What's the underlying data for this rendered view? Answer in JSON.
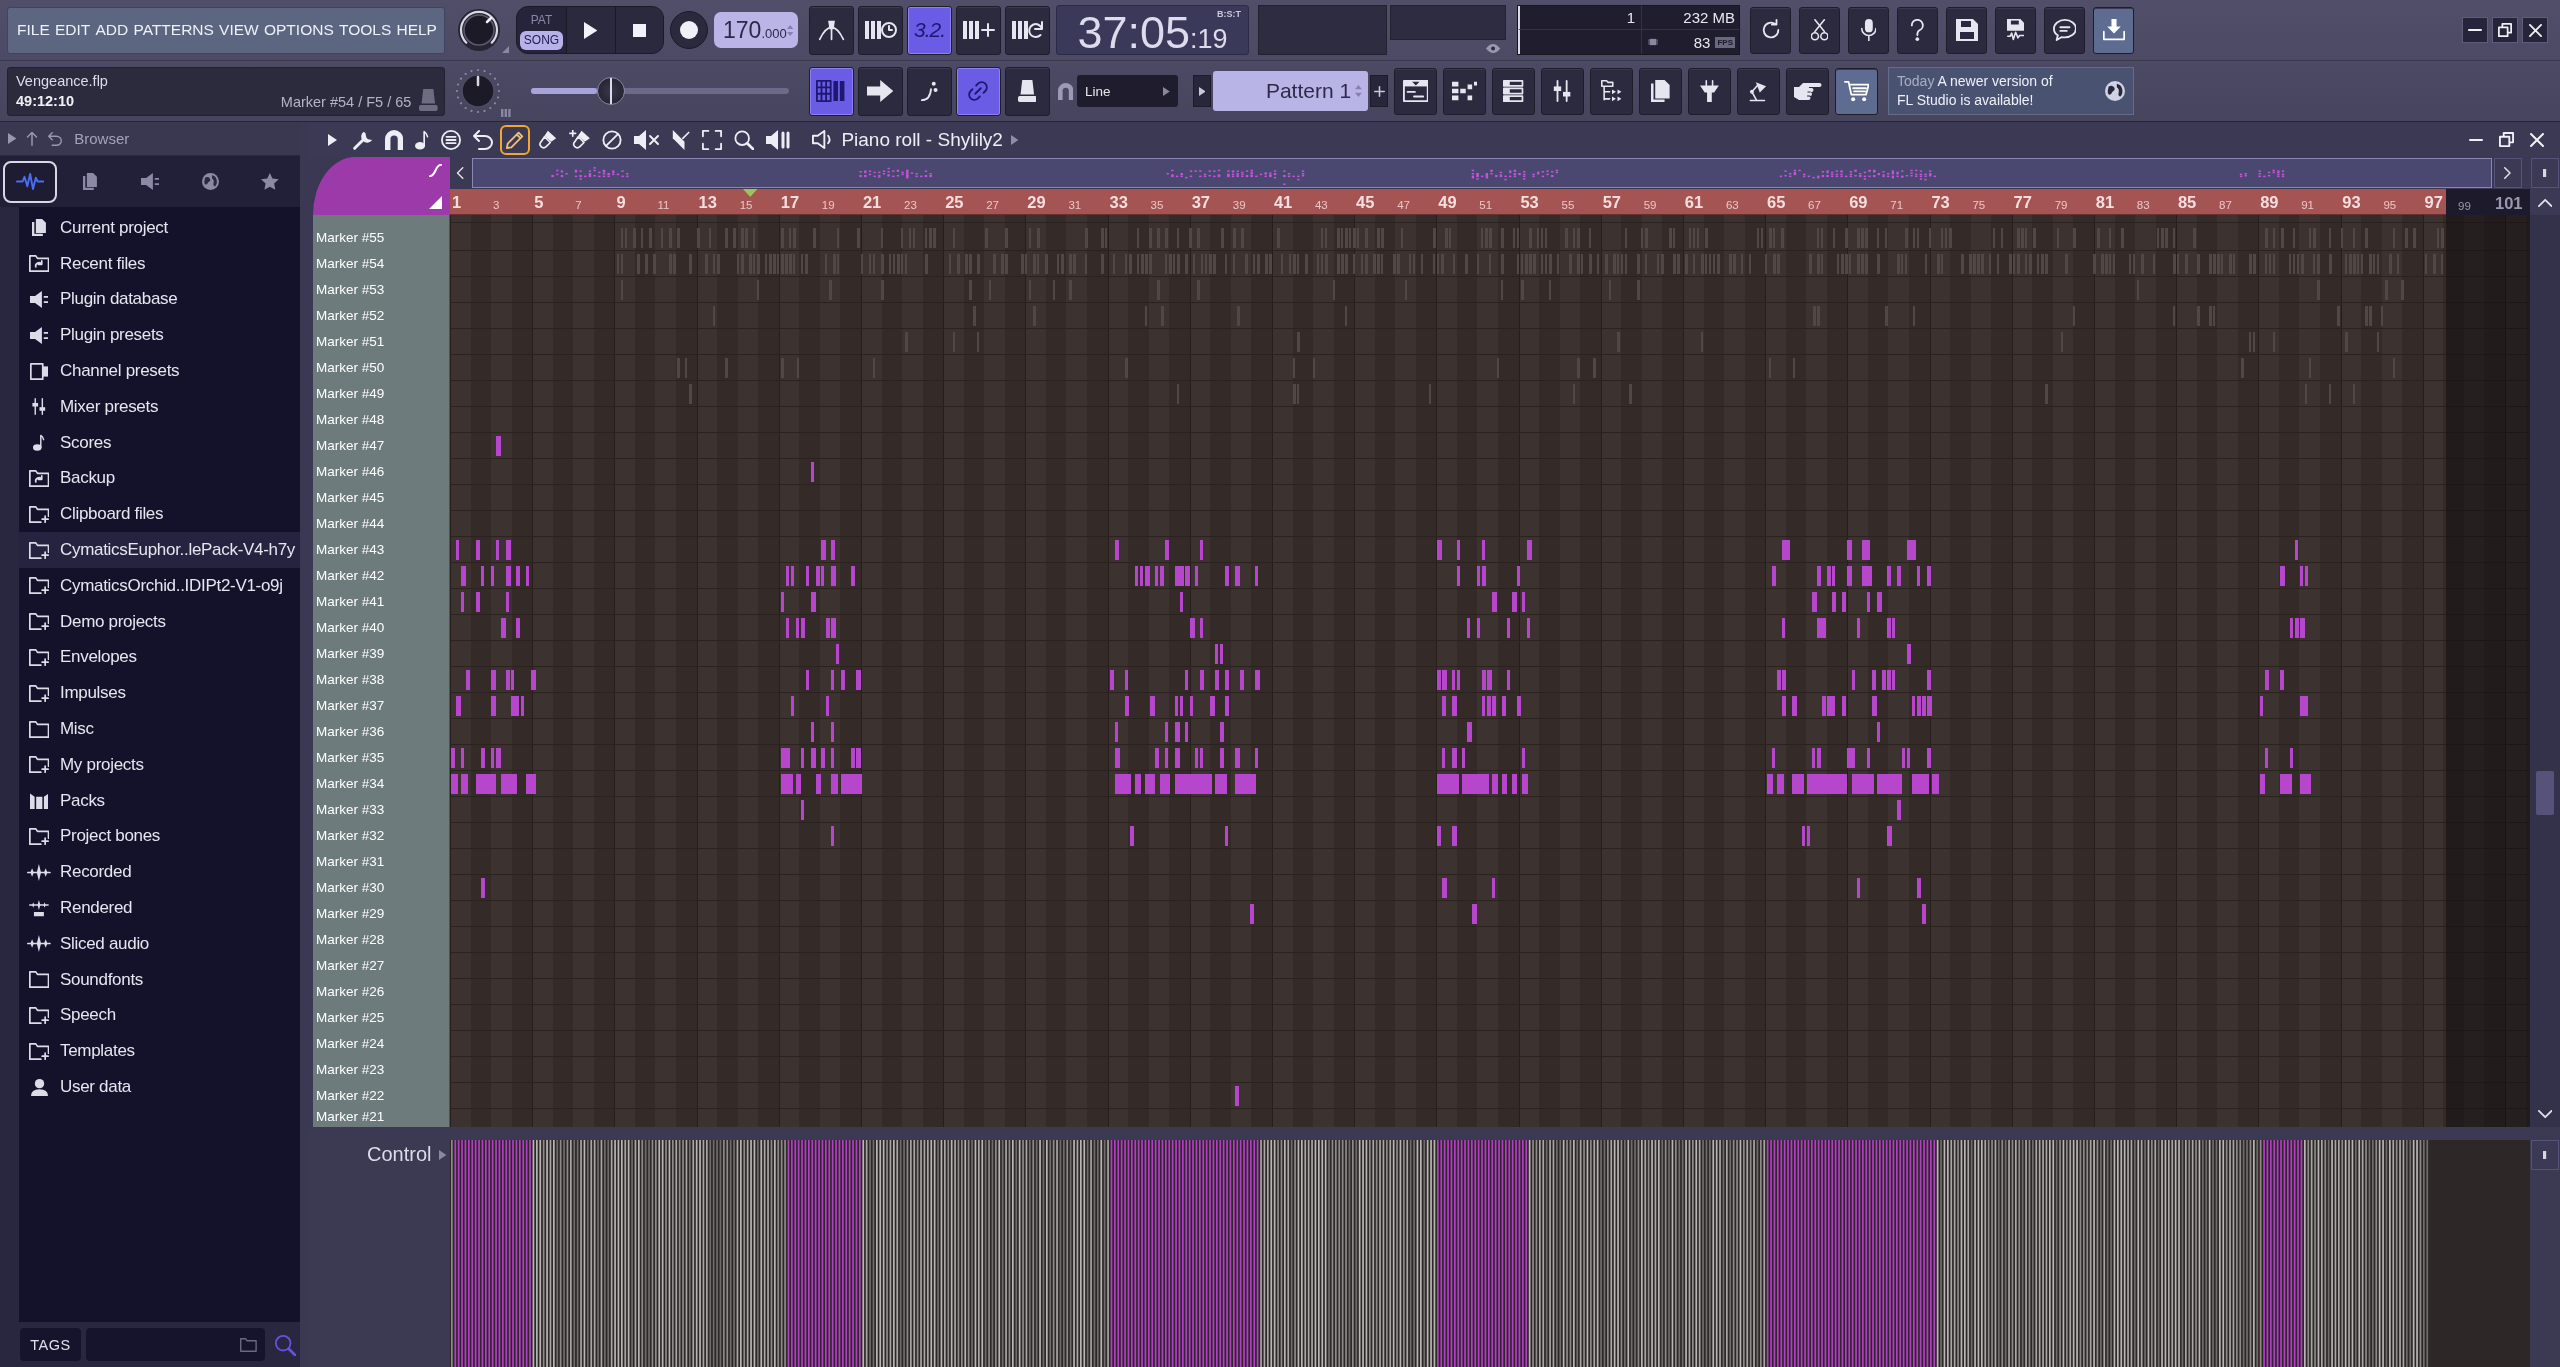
{
  "menu": [
    "FILE",
    "EDIT",
    "ADD",
    "PATTERNS",
    "VIEW",
    "OPTIONS",
    "TOOLS",
    "HELP"
  ],
  "hint_panel": {
    "project": "Vengeance.flp",
    "position": "49:12:10",
    "hint": "Marker #54 / F5 / 65"
  },
  "transport": {
    "modes": [
      {
        "label": "PAT",
        "selected": false
      },
      {
        "label": "SONG",
        "selected": true
      }
    ],
    "tempo_whole": "170",
    "tempo_fraction": ".000"
  },
  "pitch_slider": {
    "level": 0.31
  },
  "tool_buttons_top": [
    {
      "selected": false
    },
    {
      "selected": false
    },
    {
      "label": "3.2.",
      "selected": true
    },
    {
      "selected": false
    },
    {
      "selected": false
    }
  ],
  "tool_buttons_bottom": [
    {
      "selected": true
    },
    {
      "selected": false
    },
    {
      "selected": false
    },
    {
      "selected": true
    },
    {
      "selected": false
    }
  ],
  "time_display": {
    "value": "37:05",
    "fine": ":19",
    "format": "B:S:T"
  },
  "monitor": {
    "polyphony": "1",
    "memory": "232 MB",
    "cpu": "83",
    "fps_label": "FPS"
  },
  "shortcut_buttons": [
    {
      "highlighted": false
    },
    {
      "highlighted": false
    },
    {
      "highlighted": false
    },
    {
      "highlighted": false
    },
    {
      "highlighted": false
    },
    {
      "highlighted": false
    },
    {
      "highlighted": false
    },
    {
      "highlighted": true
    }
  ],
  "snap": {
    "value": "Line"
  },
  "pattern": {
    "name": "Pattern 1"
  },
  "window_buttons": [
    {
      "highlighted": false
    },
    {
      "highlighted": false
    },
    {
      "highlighted": false
    },
    {
      "highlighted": false
    },
    {
      "highlighted": false
    },
    {
      "highlighted": false
    },
    {
      "highlighted": false
    },
    {
      "highlighted": false
    },
    {
      "highlighted": false
    },
    {
      "highlighted": true
    }
  ],
  "news": {
    "date": "Today",
    "message": "A newer version of FL Studio is available!"
  },
  "browser": {
    "title": "Browser",
    "tabs": [
      {
        "selected": true
      },
      {
        "selected": false
      },
      {
        "selected": false
      },
      {
        "selected": false
      },
      {
        "selected": false
      }
    ],
    "items": [
      {
        "label": "Current project",
        "selected": false
      },
      {
        "label": "Recent files",
        "selected": false
      },
      {
        "label": "Plugin database",
        "selected": false
      },
      {
        "label": "Plugin presets",
        "selected": false
      },
      {
        "label": "Channel presets",
        "selected": false
      },
      {
        "label": "Mixer presets",
        "selected": false
      },
      {
        "label": "Scores",
        "selected": false
      },
      {
        "label": "Backup",
        "selected": false
      },
      {
        "label": "Clipboard files",
        "selected": false
      },
      {
        "label": "CymaticsEuphor..lePack-V4-h7y",
        "selected": true
      },
      {
        "label": "CymaticsOrchid..IDIPt2-V1-o9j",
        "selected": false
      },
      {
        "label": "Demo projects",
        "selected": false
      },
      {
        "label": "Envelopes",
        "selected": false
      },
      {
        "label": "Impulses",
        "selected": false
      },
      {
        "label": "Misc",
        "selected": false
      },
      {
        "label": "My projects",
        "selected": false
      },
      {
        "label": "Packs",
        "selected": false
      },
      {
        "label": "Project bones",
        "selected": false
      },
      {
        "label": "Recorded",
        "selected": false
      },
      {
        "label": "Rendered",
        "selected": false
      },
      {
        "label": "Sliced audio",
        "selected": false
      },
      {
        "label": "Soundfonts",
        "selected": false
      },
      {
        "label": "Speech",
        "selected": false
      },
      {
        "label": "Templates",
        "selected": false
      },
      {
        "label": "User data",
        "selected": false
      }
    ],
    "tags_label": "TAGS"
  },
  "piano_roll": {
    "title": "Piano roll - Shylily2",
    "tools": [
      {
        "selected": false
      },
      {
        "selected": false
      },
      {
        "selected": false
      },
      {
        "selected": false
      },
      {
        "selected": false
      },
      {
        "selected": true
      },
      {
        "selected": false
      },
      {
        "selected": false
      },
      {
        "selected": false
      },
      {
        "selected": false
      },
      {
        "selected": false
      },
      {
        "selected": false
      },
      {
        "selected": false
      },
      {
        "selected": false
      }
    ],
    "ruler": {
      "bars": [
        "1",
        "3",
        "5",
        "7",
        "9",
        "11",
        "13",
        "15",
        "17",
        "19",
        "21",
        "23",
        "25",
        "27",
        "29",
        "31",
        "33",
        "35",
        "37",
        "39",
        "41",
        "43",
        "45",
        "47",
        "49",
        "51",
        "53",
        "55",
        "57",
        "59",
        "61",
        "63",
        "65",
        "67",
        "69",
        "71",
        "73",
        "75",
        "77",
        "79",
        "81",
        "83",
        "85",
        "87",
        "89",
        "91",
        "93",
        "95",
        "97"
      ],
      "bars_past_end": [
        "99",
        "101"
      ]
    },
    "markers": [
      "Marker #55",
      "Marker #54",
      "Marker #53",
      "Marker #52",
      "Marker #51",
      "Marker #50",
      "Marker #49",
      "Marker #48",
      "Marker #47",
      "Marker #46",
      "Marker #45",
      "Marker #44",
      "Marker #43",
      "Marker #42",
      "Marker #41",
      "Marker #40",
      "Marker #39",
      "Marker #38",
      "Marker #37",
      "Marker #36",
      "Marker #35",
      "Marker #34",
      "Marker #33",
      "Marker #32",
      "Marker #31",
      "Marker #30",
      "Marker #29",
      "Marker #28",
      "Marker #27",
      "Marker #26",
      "Marker #25",
      "Marker #24",
      "Marker #23",
      "Marker #22",
      "Marker #21"
    ],
    "control_label": "Control"
  }
}
